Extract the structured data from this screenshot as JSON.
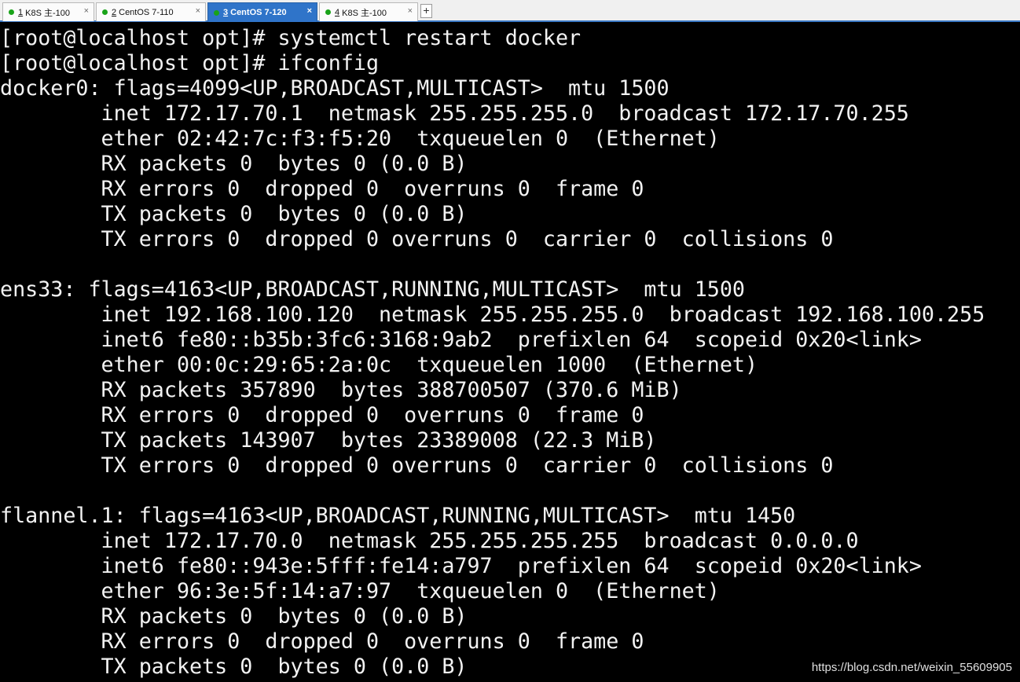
{
  "tabs": [
    {
      "num": "1",
      "label": "K8S 主-100",
      "active": false,
      "close": "×"
    },
    {
      "num": "2",
      "label": "CentOS 7-110",
      "active": false,
      "close": "×"
    },
    {
      "num": "3",
      "label": "CentOS 7-120",
      "active": true,
      "close": "×"
    },
    {
      "num": "4",
      "label": "K8S 主-100",
      "active": false,
      "close": "×"
    }
  ],
  "add_tab_label": "+",
  "status_color": "#19a319",
  "terminal": {
    "lines": [
      "[root@localhost opt]# systemctl restart docker",
      "[root@localhost opt]# ifconfig",
      "docker0: flags=4099<UP,BROADCAST,MULTICAST>  mtu 1500",
      "        inet 172.17.70.1  netmask 255.255.255.0  broadcast 172.17.70.255",
      "        ether 02:42:7c:f3:f5:20  txqueuelen 0  (Ethernet)",
      "        RX packets 0  bytes 0 (0.0 B)",
      "        RX errors 0  dropped 0  overruns 0  frame 0",
      "        TX packets 0  bytes 0 (0.0 B)",
      "        TX errors 0  dropped 0 overruns 0  carrier 0  collisions 0",
      "",
      "ens33: flags=4163<UP,BROADCAST,RUNNING,MULTICAST>  mtu 1500",
      "        inet 192.168.100.120  netmask 255.255.255.0  broadcast 192.168.100.255",
      "        inet6 fe80::b35b:3fc6:3168:9ab2  prefixlen 64  scopeid 0x20<link>",
      "        ether 00:0c:29:65:2a:0c  txqueuelen 1000  (Ethernet)",
      "        RX packets 357890  bytes 388700507 (370.6 MiB)",
      "        RX errors 0  dropped 0  overruns 0  frame 0",
      "        TX packets 143907  bytes 23389008 (22.3 MiB)",
      "        TX errors 0  dropped 0 overruns 0  carrier 0  collisions 0",
      "",
      "flannel.1: flags=4163<UP,BROADCAST,RUNNING,MULTICAST>  mtu 1450",
      "        inet 172.17.70.0  netmask 255.255.255.255  broadcast 0.0.0.0",
      "        inet6 fe80::943e:5fff:fe14:a797  prefixlen 64  scopeid 0x20<link>",
      "        ether 96:3e:5f:14:a7:97  txqueuelen 0  (Ethernet)",
      "        RX packets 0  bytes 0 (0.0 B)",
      "        RX errors 0  dropped 0  overruns 0  frame 0",
      "        TX packets 0  bytes 0 (0.0 B)"
    ]
  },
  "watermark": "https://blog.csdn.net/weixin_55609905"
}
